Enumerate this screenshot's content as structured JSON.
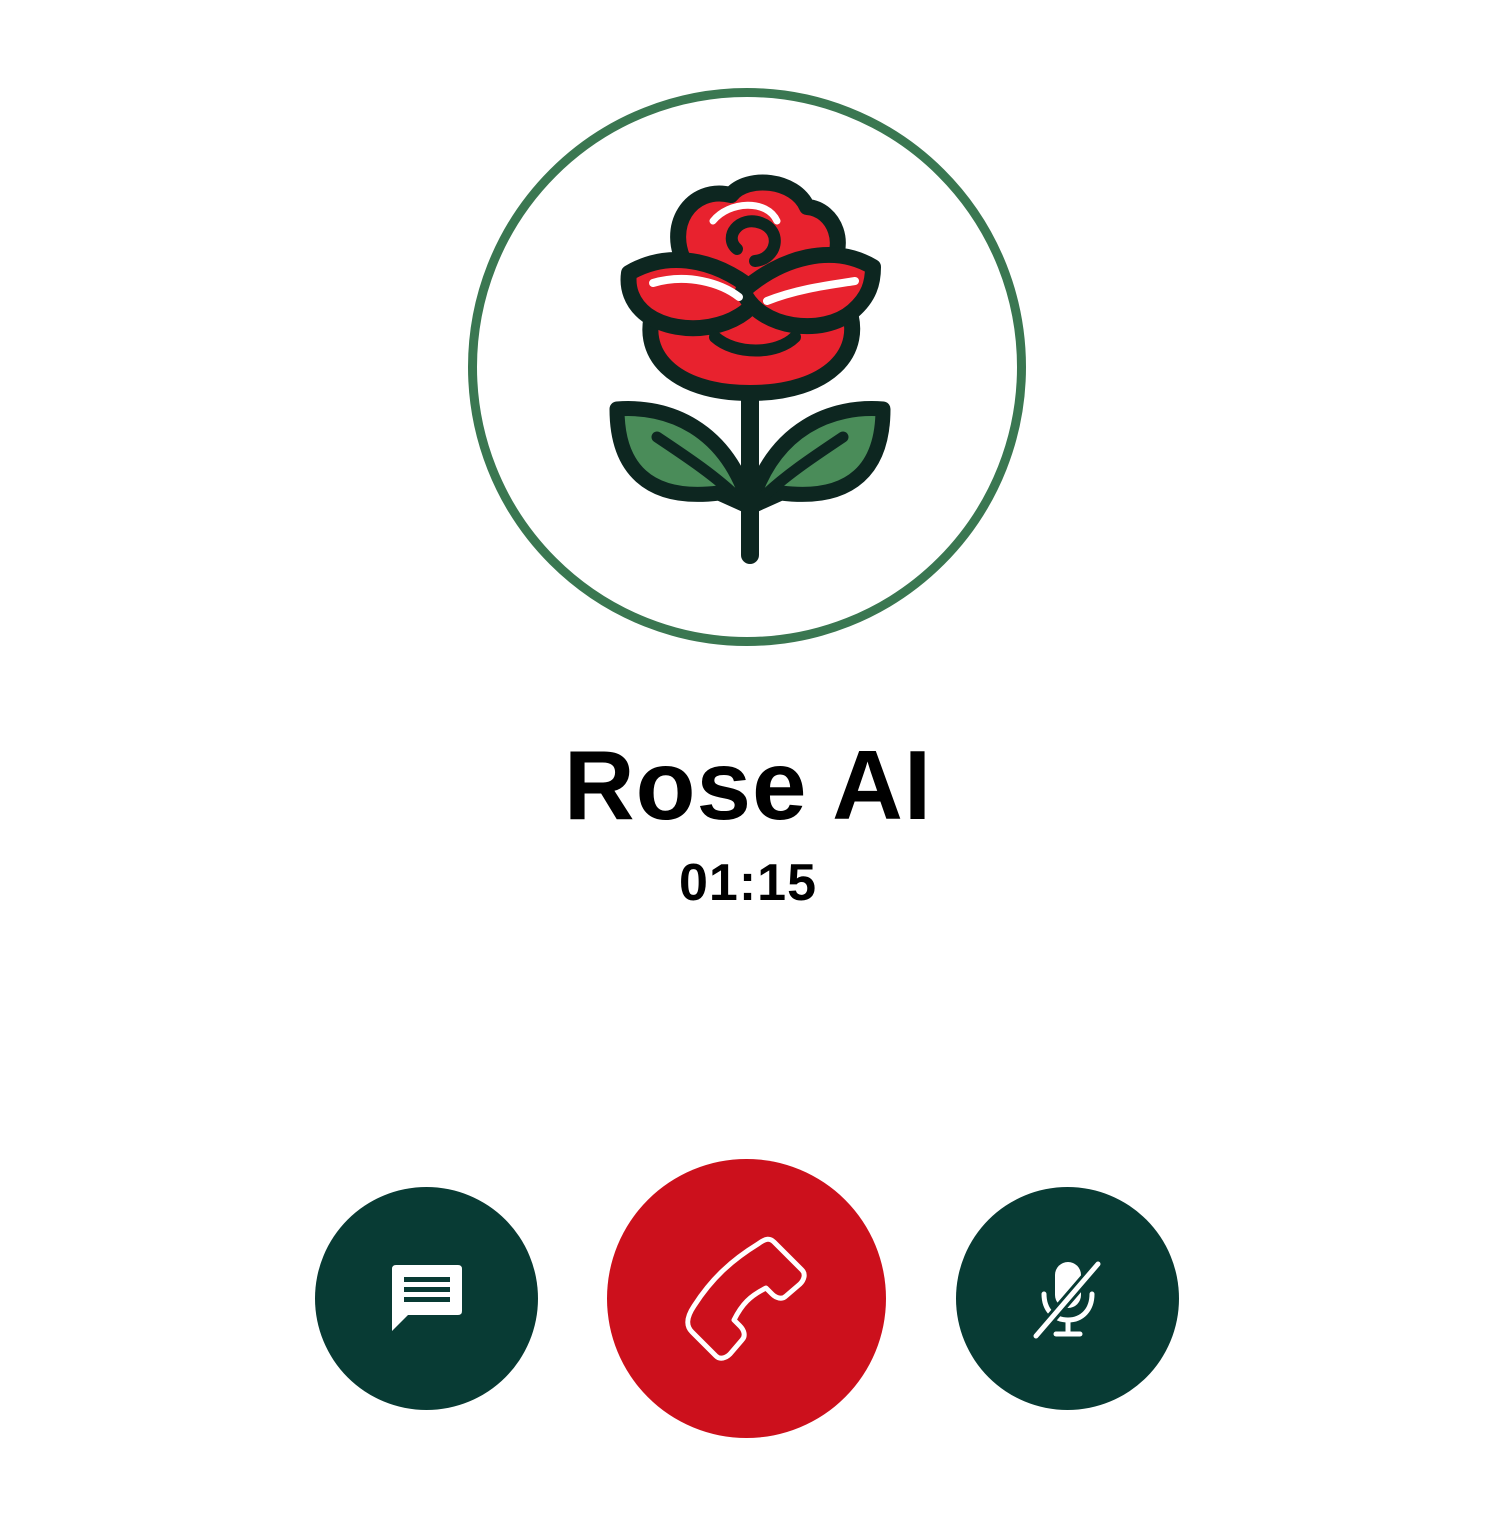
{
  "call": {
    "contact_name": "Rose AI",
    "duration": "01:15",
    "avatar_icon": "rose-icon"
  },
  "controls": [
    {
      "name": "message-button",
      "icon": "message-icon"
    },
    {
      "name": "end-call-button",
      "icon": "phone-hangup-icon"
    },
    {
      "name": "mute-button",
      "icon": "microphone-off-icon"
    }
  ],
  "colors": {
    "avatar_ring": "#3a7751",
    "control_dark": "#083b34",
    "end_call_red": "#cc101c",
    "rose_red": "#e8222e",
    "leaf_green": "#4a8c59",
    "outline": "#0d2620"
  }
}
